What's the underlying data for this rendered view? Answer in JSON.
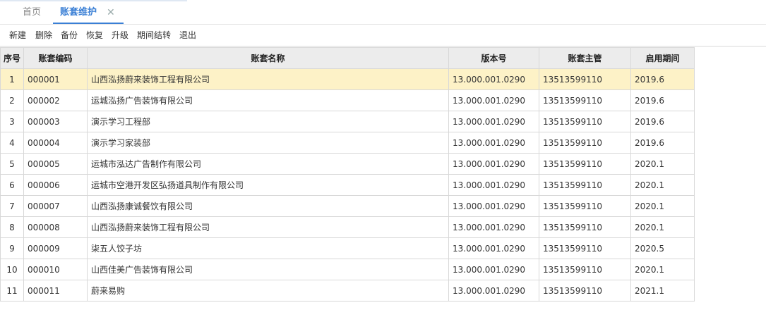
{
  "tabs": {
    "home": "首页",
    "active": "账套维护",
    "close_glyph": "✕"
  },
  "toolbar": [
    "新建",
    "删除",
    "备份",
    "恢复",
    "升级",
    "期间结转",
    "退出"
  ],
  "table": {
    "columns": [
      "序号",
      "账套编码",
      "账套名称",
      "版本号",
      "账套主管",
      "启用期间"
    ],
    "selected_row": 0,
    "rows": [
      [
        "1",
        "000001",
        "山西泓扬蔚来装饰工程有限公司",
        "13.000.001.0290",
        "13513599110",
        "2019.6"
      ],
      [
        "2",
        "000002",
        "运城泓扬广告装饰有限公司",
        "13.000.001.0290",
        "13513599110",
        "2019.6"
      ],
      [
        "3",
        "000003",
        "演示学习工程部",
        "13.000.001.0290",
        "13513599110",
        "2019.6"
      ],
      [
        "4",
        "000004",
        "演示学习家装部",
        "13.000.001.0290",
        "13513599110",
        "2019.6"
      ],
      [
        "5",
        "000005",
        "运城市泓达广告制作有限公司",
        "13.000.001.0290",
        "13513599110",
        "2020.1"
      ],
      [
        "6",
        "000006",
        "运城市空港开发区弘扬道具制作有限公司",
        "13.000.001.0290",
        "13513599110",
        "2020.1"
      ],
      [
        "7",
        "000007",
        "山西泓扬康诚餐饮有限公司",
        "13.000.001.0290",
        "13513599110",
        "2020.1"
      ],
      [
        "8",
        "000008",
        "山西泓扬蔚来装饰工程有限公司",
        "13.000.001.0290",
        "13513599110",
        "2020.1"
      ],
      [
        "9",
        "000009",
        "柒五人饺子坊",
        "13.000.001.0290",
        "13513599110",
        "2020.5"
      ],
      [
        "10",
        "000010",
        "山西佳美广告装饰有限公司",
        "13.000.001.0290",
        "13513599110",
        "2020.1"
      ],
      [
        "11",
        "000011",
        "蔚来易购",
        "13.000.001.0290",
        "13513599110",
        "2021.1"
      ]
    ]
  }
}
